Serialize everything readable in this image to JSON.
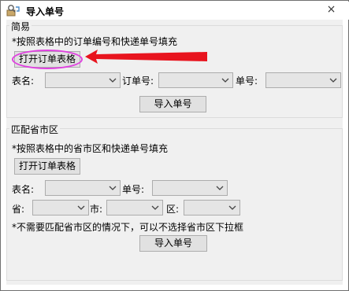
{
  "window": {
    "title": "导入单号",
    "close_glyph": "×"
  },
  "simple": {
    "legend": "简易",
    "instruction": "*按照表格中的订单编号和快递单号填充",
    "open_button": "打开订单表格",
    "sheet_label": "表名:",
    "order_label": "订单号:",
    "tracking_label": "单号:",
    "import_button": "导入单号"
  },
  "match": {
    "legend": "匹配省市区",
    "instruction": "*按照表格中的省市区和快递单号填充",
    "open_button": "打开订单表格",
    "sheet_label": "表名:",
    "tracking_label": "单号:",
    "province_label": "省:",
    "city_label": "市:",
    "district_label": "区:",
    "note": "*不需要匹配省市区的情况下，可以不选择省市区下拉框",
    "import_button": "导入单号"
  },
  "annotation": {
    "arrow_color": "#e8141e",
    "circle_color": "#e040e0"
  }
}
